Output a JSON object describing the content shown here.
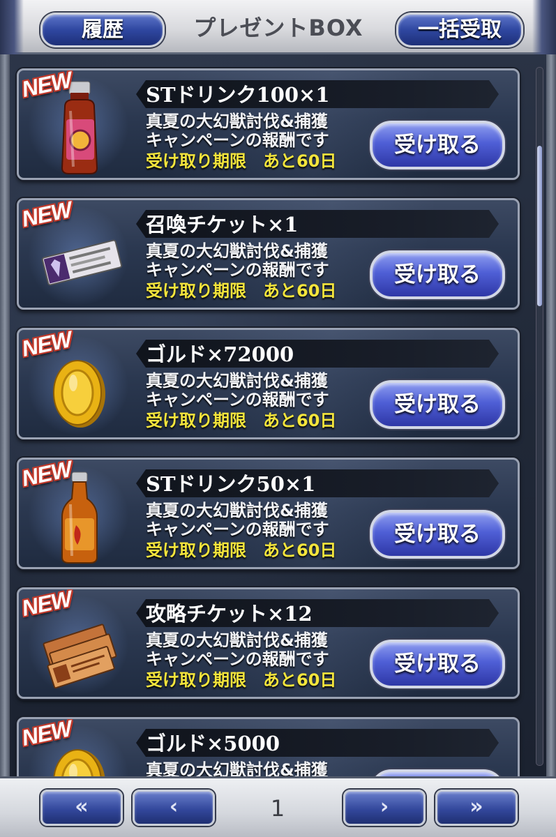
{
  "header": {
    "history_label": "履歴",
    "title": "プレゼントBOX",
    "bulk_receive_label": "一括受取"
  },
  "badge_label": "NEW",
  "receive_label": "受け取る",
  "items": [
    {
      "name": "STドリンク100×1",
      "icon": "st-drink-100-icon",
      "desc_line1": "真夏の大幻獣討伐&捕獲",
      "desc_line2": "キャンペーンの報酬です",
      "deadline": "受け取り期限　あと60日"
    },
    {
      "name": "召喚チケット×1",
      "icon": "summon-ticket-icon",
      "desc_line1": "真夏の大幻獣討伐&捕獲",
      "desc_line2": "キャンペーンの報酬です",
      "deadline": "受け取り期限　あと60日"
    },
    {
      "name": "ゴルド×72000",
      "icon": "gold-coin-icon",
      "desc_line1": "真夏の大幻獣討伐&捕獲",
      "desc_line2": "キャンペーンの報酬です",
      "deadline": "受け取り期限　あと60日"
    },
    {
      "name": "STドリンク50×1",
      "icon": "st-drink-50-icon",
      "desc_line1": "真夏の大幻獣討伐&捕獲",
      "desc_line2": "キャンペーンの報酬です",
      "deadline": "受け取り期限　あと60日"
    },
    {
      "name": "攻略チケット×12",
      "icon": "strategy-ticket-icon",
      "desc_line1": "真夏の大幻獣討伐&捕獲",
      "desc_line2": "キャンペーンの報酬です",
      "deadline": "受け取り期限　あと60日"
    },
    {
      "name": "ゴルド×5000",
      "icon": "gold-coin-icon",
      "desc_line1": "真夏の大幻獣討伐&捕獲",
      "desc_line2": "",
      "deadline": ""
    }
  ],
  "pagination": {
    "first": "«",
    "prev": "‹",
    "page": "1",
    "next": "›",
    "last": "»"
  }
}
